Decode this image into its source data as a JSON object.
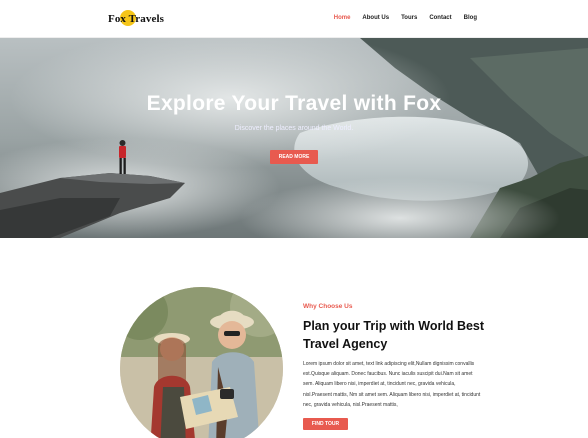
{
  "brand": {
    "name": "Fox Travels"
  },
  "nav": {
    "items": [
      {
        "label": "Home",
        "active": true
      },
      {
        "label": "About Us"
      },
      {
        "label": "Tours"
      },
      {
        "label": "Contact"
      },
      {
        "label": "Blog"
      }
    ]
  },
  "hero": {
    "title": "Explore Your Travel with Fox",
    "subtitle": "Discover the places around the World.",
    "button_label": "READ MORE"
  },
  "about": {
    "eyebrow": "Why Choose Us",
    "title": "Plan your Trip with World Best Travel Agency",
    "text": "Lorem ipsum dolor sit amet, text link adipiscing elit,Nullam dignissim convallis est.Quisque aliquam. Donec faucibus. Nunc iaculis suscipit dui.Nam sit amet sem. Aliquam libero nisi, imperdiet at, tincidunt nec, gravida vehicula, nisl.Praesent mattis, Nm sit amet sem. Aliquam libero nisi, imperdiet at, tincidunt nec, gravida vehicula, nisl.Praesent mattis,",
    "button_label": "FIND TOUR"
  },
  "colors": {
    "accent": "#e85a4f",
    "logo_dot": "#f5c518"
  }
}
